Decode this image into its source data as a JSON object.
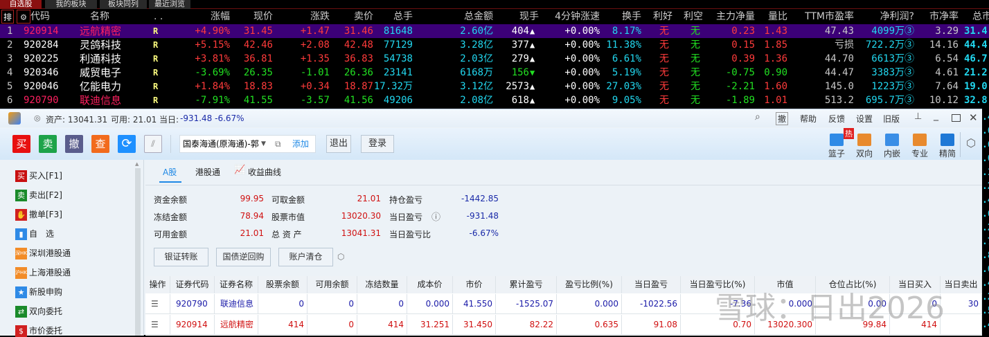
{
  "quote_tabs": [
    "自选股",
    "我的板块",
    "板块同列",
    "最近浏览"
  ],
  "quote_header": {
    "sort": "排",
    "code": "代码",
    "name": "名称",
    "dots": ". .",
    "chg_pct": "涨幅",
    "price": "现价",
    "chg": "涨跌",
    "ask": "卖价",
    "vol": "总手",
    "amount": "总金额",
    "cur_vol": "现手",
    "speed": "4分钟涨速",
    "turnover": "换手",
    "good": "利好",
    "bad": "利空",
    "main_net": "主力净量",
    "vol_ratio": "量比",
    "pe": "TTM市盈率",
    "profit": "净利润?",
    "pb": "市净率",
    "mcap": "总市"
  },
  "quotes": [
    {
      "idx": "1",
      "code": "920914",
      "name": "远航精密",
      "flag": "R",
      "chg_pct": "+4.90%",
      "price": "31.45",
      "chg": "+1.47",
      "ask": "31.46",
      "vol": "81648",
      "amount": "2.60亿",
      "cur_vol": "404",
      "dir": "up",
      "speed": "+0.00%",
      "turnover": "8.17%",
      "good": "无",
      "bad": "无",
      "main_net": "0.23",
      "vol_ratio": "1.43",
      "pe": "47.43",
      "profit": "4099万③",
      "pb": "3.29",
      "mcap": "31.4",
      "up": true,
      "hl": true
    },
    {
      "idx": "2",
      "code": "920284",
      "name": "灵鸽科技",
      "flag": "R",
      "chg_pct": "+5.15%",
      "price": "42.46",
      "chg": "+2.08",
      "ask": "42.48",
      "vol": "77129",
      "amount": "3.28亿",
      "cur_vol": "377",
      "dir": "up",
      "speed": "+0.00%",
      "turnover": "11.38%",
      "good": "无",
      "bad": "无",
      "main_net": "0.15",
      "vol_ratio": "1.85",
      "pe": "亏损",
      "profit": "722.2万③",
      "pb": "14.16",
      "mcap": "44.4",
      "up": true
    },
    {
      "idx": "3",
      "code": "920225",
      "name": "利通科技",
      "flag": "R",
      "chg_pct": "+3.81%",
      "price": "36.81",
      "chg": "+1.35",
      "ask": "36.83",
      "vol": "54738",
      "amount": "2.03亿",
      "cur_vol": "279",
      "dir": "up",
      "speed": "+0.00%",
      "turnover": "6.61%",
      "good": "无",
      "bad": "无",
      "main_net": "0.39",
      "vol_ratio": "1.36",
      "pe": "44.70",
      "profit": "6613万③",
      "pb": "6.54",
      "mcap": "46.7",
      "up": true
    },
    {
      "idx": "4",
      "code": "920346",
      "name": "威贸电子",
      "flag": "R",
      "chg_pct": "-3.69%",
      "price": "26.35",
      "chg": "-1.01",
      "ask": "26.36",
      "vol": "23141",
      "amount": "6168万",
      "cur_vol": "156",
      "dir": "down",
      "speed": "+0.00%",
      "turnover": "5.19%",
      "good": "无",
      "bad": "无",
      "main_net": "-0.75",
      "vol_ratio": "0.90",
      "pe": "44.47",
      "profit": "3383万③",
      "pb": "4.61",
      "mcap": "21.2",
      "up": false
    },
    {
      "idx": "5",
      "code": "920046",
      "name": "亿能电力",
      "flag": "R",
      "chg_pct": "+1.84%",
      "price": "18.83",
      "chg": "+0.34",
      "ask": "18.87",
      "vol": "17.32万",
      "amount": "3.12亿",
      "cur_vol": "2573",
      "dir": "up",
      "speed": "+0.00%",
      "turnover": "27.03%",
      "good": "无",
      "bad": "无",
      "main_net": "-2.21",
      "vol_ratio": "1.60",
      "pe": "145.0",
      "profit": "1223万③",
      "pb": "7.64",
      "mcap": "19.0",
      "up": true
    },
    {
      "idx": "6",
      "code": "920790",
      "name": "联迪信息",
      "flag": "R",
      "chg_pct": "-7.91%",
      "price": "41.55",
      "chg": "-3.57",
      "ask": "41.56",
      "vol": "49206",
      "amount": "2.08亿",
      "cur_vol": "618",
      "dir": "up",
      "speed": "+0.00%",
      "turnover": "9.05%",
      "good": "无",
      "bad": "无",
      "main_net": "-1.89",
      "vol_ratio": "1.01",
      "pe": "513.2",
      "profit": "695.7万③",
      "pb": "10.12",
      "mcap": "32.8",
      "up": false,
      "hl": true
    }
  ],
  "right_strip": [
    ".4",
    ".0",
    ".6",
    ".0",
    ".1",
    ".2",
    ".4",
    ".6",
    ".2",
    ".7",
    ".8",
    ".0",
    ".4",
    ".2",
    ".5",
    ".4"
  ],
  "trade": {
    "title_info": {
      "asset": "资产: 13041.31",
      "avail": "可用: 21.01",
      "today_label": "当日:",
      "today": "-931.48 -6.67%"
    },
    "title_menu": [
      "撤",
      "帮助",
      "反馈",
      "设置",
      "旧版"
    ],
    "quick": [
      "买",
      "卖",
      "撤",
      "查"
    ],
    "broker": "国泰海通(原海通)-郭",
    "add": "添加",
    "logout": "退出",
    "login": "登录",
    "right_tools": [
      "篮子",
      "双向",
      "内嵌",
      "专业",
      "精简"
    ],
    "hot": "热",
    "sidebar": [
      "买入[F1]",
      "卖出[F2]",
      "撤单[F3]",
      "自　选",
      "深圳港股通",
      "上海港股通",
      "新股申购",
      "双向委托",
      "市价委托"
    ],
    "sidebar_icons": [
      "买",
      "卖",
      "✋",
      "▮",
      "深HK",
      "沪HK",
      "★",
      "⇄",
      "$"
    ],
    "tabs": [
      "A股",
      "港股通",
      "收益曲线"
    ],
    "summary": [
      {
        "label": "资金余额",
        "value": "99.95"
      },
      {
        "label": "可取金额",
        "value": "21.01"
      },
      {
        "label": "持仓盈亏",
        "value": "-1442.85"
      },
      {
        "label": "冻结金额",
        "value": "78.94"
      },
      {
        "label": "股票市值",
        "value": "13020.30"
      },
      {
        "label": "当日盈亏",
        "value": "-931.48"
      },
      {
        "label": "可用金额",
        "value": "21.01"
      },
      {
        "label": "总 资 产",
        "value": "13041.31"
      },
      {
        "label": "当日盈亏比",
        "value": "-6.67%"
      }
    ],
    "actions": [
      "银证转账",
      "国债逆回购",
      "账户清仓"
    ],
    "columns": [
      "操作",
      "证券代码",
      "证券名称",
      "股票余额",
      "可用余额",
      "冻结数量",
      "成本价",
      "市价",
      "累计盈亏",
      "盈亏比例(%)",
      "当日盈亏",
      "当日盈亏比(%)",
      "市值",
      "仓位占比(%)",
      "当日买入",
      "当日卖出"
    ],
    "positions": [
      {
        "color": "#1a1aa8",
        "cells": [
          "☰",
          "920790",
          "联迪信息",
          "0",
          "0",
          "0",
          "0.000",
          "41.550",
          "-1525.07",
          "0.000",
          "-1022.56",
          "-7.36",
          "0.000",
          "0.00",
          "0",
          "30"
        ]
      },
      {
        "color": "#d01010",
        "cells": [
          "☰",
          "920914",
          "远航精密",
          "414",
          "0",
          "414",
          "31.251",
          "31.450",
          "82.22",
          "0.635",
          "91.08",
          "0.70",
          "13020.300",
          "99.84",
          "414",
          ""
        ]
      }
    ]
  },
  "watermark": "雪球：日出2026",
  "colors": {
    "up": "#ff3b3b",
    "down": "#22e022",
    "select": "#3c0078",
    "accent": "#1e88e5"
  }
}
